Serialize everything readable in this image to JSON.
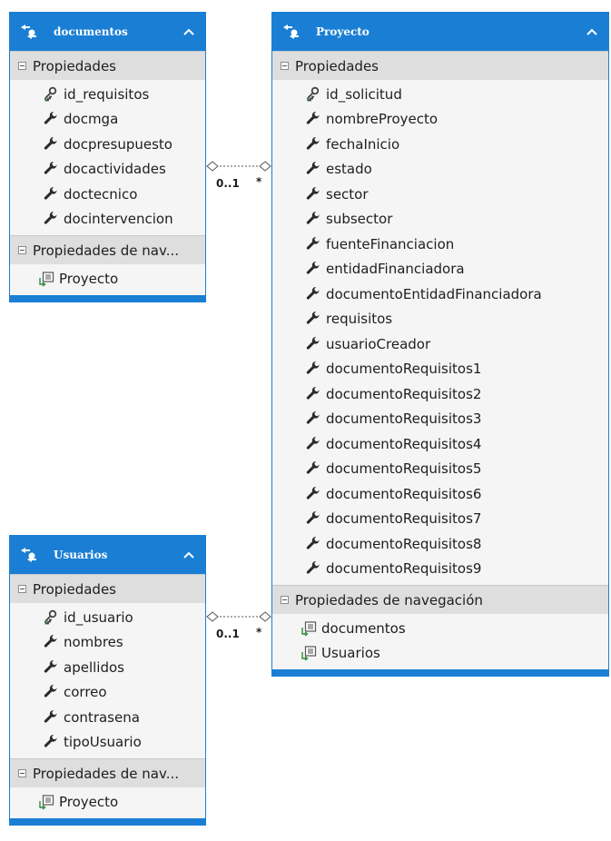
{
  "colors": {
    "accent": "#1a7fd4",
    "section_bg": "#dedede",
    "entity_bg": "#f5f5f5"
  },
  "entities": {
    "documentos": {
      "title": "documentos",
      "properties_label": "Propiedades",
      "properties": [
        {
          "name": "id_requisitos",
          "icon": "key-icon"
        },
        {
          "name": "docmga",
          "icon": "wrench-icon"
        },
        {
          "name": "docpresupuesto",
          "icon": "wrench-icon"
        },
        {
          "name": "docactividades",
          "icon": "wrench-icon"
        },
        {
          "name": "doctecnico",
          "icon": "wrench-icon"
        },
        {
          "name": "docintervencion",
          "icon": "wrench-icon"
        }
      ],
      "nav_label": "Propiedades de nav...",
      "nav": [
        {
          "name": "Proyecto",
          "icon": "navigation-property-icon"
        }
      ]
    },
    "proyecto": {
      "title": "Proyecto",
      "properties_label": "Propiedades",
      "properties": [
        {
          "name": "id_solicitud",
          "icon": "key-icon"
        },
        {
          "name": "nombreProyecto",
          "icon": "wrench-icon"
        },
        {
          "name": "fechaInicio",
          "icon": "wrench-icon"
        },
        {
          "name": "estado",
          "icon": "wrench-icon"
        },
        {
          "name": "sector",
          "icon": "wrench-icon"
        },
        {
          "name": "subsector",
          "icon": "wrench-icon"
        },
        {
          "name": "fuenteFinanciacion",
          "icon": "wrench-icon"
        },
        {
          "name": "entidadFinanciadora",
          "icon": "wrench-icon"
        },
        {
          "name": "documentoEntidadFinanciadora",
          "icon": "wrench-icon"
        },
        {
          "name": "requisitos",
          "icon": "wrench-icon"
        },
        {
          "name": "usuarioCreador",
          "icon": "wrench-icon"
        },
        {
          "name": "documentoRequisitos1",
          "icon": "wrench-icon"
        },
        {
          "name": "documentoRequisitos2",
          "icon": "wrench-icon"
        },
        {
          "name": "documentoRequisitos3",
          "icon": "wrench-icon"
        },
        {
          "name": "documentoRequisitos4",
          "icon": "wrench-icon"
        },
        {
          "name": "documentoRequisitos5",
          "icon": "wrench-icon"
        },
        {
          "name": "documentoRequisitos6",
          "icon": "wrench-icon"
        },
        {
          "name": "documentoRequisitos7",
          "icon": "wrench-icon"
        },
        {
          "name": "documentoRequisitos8",
          "icon": "wrench-icon"
        },
        {
          "name": "documentoRequisitos9",
          "icon": "wrench-icon"
        }
      ],
      "nav_label": "Propiedades de navegación",
      "nav": [
        {
          "name": "documentos",
          "icon": "navigation-property-icon"
        },
        {
          "name": "Usuarios",
          "icon": "navigation-property-icon"
        }
      ]
    },
    "usuarios": {
      "title": "Usuarios",
      "properties_label": "Propiedades",
      "properties": [
        {
          "name": "id_usuario",
          "icon": "key-icon"
        },
        {
          "name": "nombres",
          "icon": "wrench-icon"
        },
        {
          "name": "apellidos",
          "icon": "wrench-icon"
        },
        {
          "name": "correo",
          "icon": "wrench-icon"
        },
        {
          "name": "contrasena",
          "icon": "wrench-icon"
        },
        {
          "name": "tipoUsuario",
          "icon": "wrench-icon"
        }
      ],
      "nav_label": "Propiedades de nav...",
      "nav": [
        {
          "name": "Proyecto",
          "icon": "navigation-property-icon"
        }
      ]
    }
  },
  "associations": [
    {
      "from": "documentos",
      "to": "proyecto",
      "from_multiplicity": "0..1",
      "to_multiplicity": "*"
    },
    {
      "from": "usuarios",
      "to": "proyecto",
      "from_multiplicity": "0..1",
      "to_multiplicity": "*"
    }
  ]
}
